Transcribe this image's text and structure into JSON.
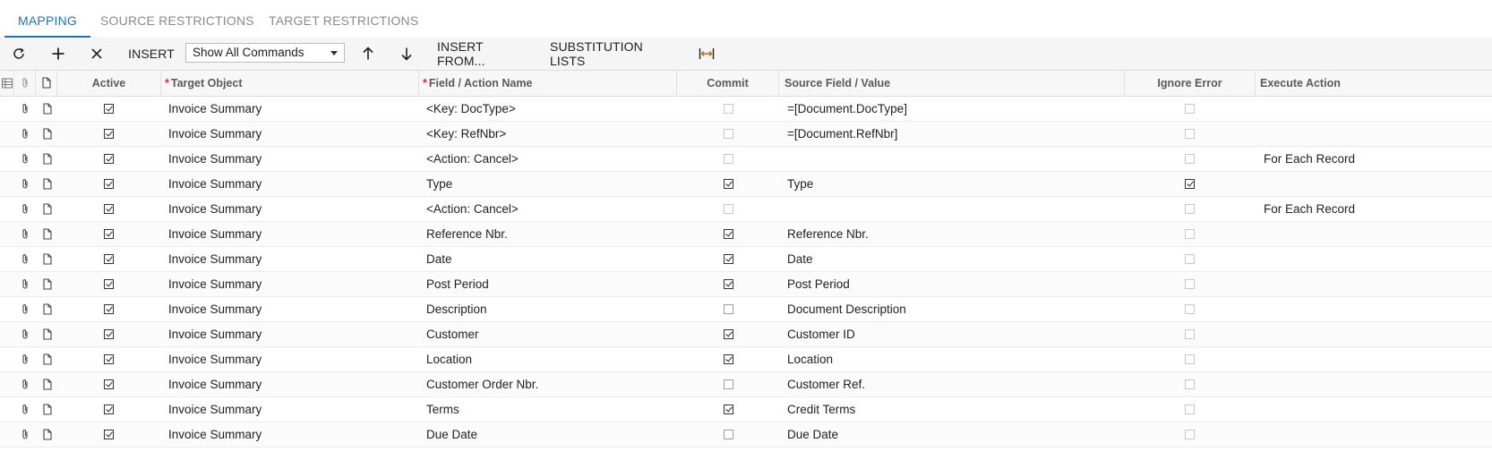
{
  "tabs": [
    {
      "label": "MAPPING",
      "active": true
    },
    {
      "label": "SOURCE RESTRICTIONS",
      "active": false
    },
    {
      "label": "TARGET RESTRICTIONS",
      "active": false
    }
  ],
  "toolbar": {
    "refresh_icon": "refresh-icon",
    "add_icon": "plus-icon",
    "delete_icon": "close-icon",
    "insert_label": "INSERT",
    "command_filter": "Show All Commands",
    "move_up_icon": "arrow-up-icon",
    "move_down_icon": "arrow-down-icon",
    "insert_from_label": "INSERT FROM...",
    "substitution_lists_label": "SUBSTITUTION LISTS",
    "fit_columns_icon": "fit-columns-icon"
  },
  "grid": {
    "columns": {
      "active": "Active",
      "target_object": "Target Object",
      "field_action": "Field / Action Name",
      "commit": "Commit",
      "source_field": "Source Field / Value",
      "ignore_error": "Ignore Error",
      "execute_action": "Execute Action"
    },
    "rows": [
      {
        "active": true,
        "target": "Invoice Summary",
        "field": "<Key: DocType>",
        "commit": false,
        "commit_enabled": false,
        "source": "=[Document.DocType]",
        "ignore_error": false,
        "execute": ""
      },
      {
        "active": true,
        "target": "Invoice Summary",
        "field": "<Key: RefNbr>",
        "commit": false,
        "commit_enabled": false,
        "source": "=[Document.RefNbr]",
        "ignore_error": false,
        "execute": ""
      },
      {
        "active": true,
        "target": "Invoice Summary",
        "field": "<Action: Cancel>",
        "commit": false,
        "commit_enabled": false,
        "source": "",
        "ignore_error": false,
        "execute": "For Each Record"
      },
      {
        "active": true,
        "target": "Invoice Summary",
        "field": "Type",
        "commit": true,
        "commit_enabled": true,
        "source": "Type",
        "ignore_error": true,
        "execute": ""
      },
      {
        "active": true,
        "target": "Invoice Summary",
        "field": "<Action: Cancel>",
        "commit": false,
        "commit_enabled": false,
        "source": "",
        "ignore_error": false,
        "execute": "For Each Record"
      },
      {
        "active": true,
        "target": "Invoice Summary",
        "field": "Reference Nbr.",
        "commit": true,
        "commit_enabled": true,
        "source": "Reference Nbr.",
        "ignore_error": false,
        "execute": ""
      },
      {
        "active": true,
        "target": "Invoice Summary",
        "field": "Date",
        "commit": true,
        "commit_enabled": true,
        "source": "Date",
        "ignore_error": false,
        "execute": ""
      },
      {
        "active": true,
        "target": "Invoice Summary",
        "field": "Post Period",
        "commit": true,
        "commit_enabled": true,
        "source": "Post Period",
        "ignore_error": false,
        "execute": ""
      },
      {
        "active": true,
        "target": "Invoice Summary",
        "field": "Description",
        "commit": false,
        "commit_enabled": true,
        "source": "Document Description",
        "ignore_error": false,
        "execute": ""
      },
      {
        "active": true,
        "target": "Invoice Summary",
        "field": "Customer",
        "commit": true,
        "commit_enabled": true,
        "source": "Customer ID",
        "ignore_error": false,
        "execute": ""
      },
      {
        "active": true,
        "target": "Invoice Summary",
        "field": "Location",
        "commit": true,
        "commit_enabled": true,
        "source": "Location",
        "ignore_error": false,
        "execute": ""
      },
      {
        "active": true,
        "target": "Invoice Summary",
        "field": "Customer Order Nbr.",
        "commit": false,
        "commit_enabled": true,
        "source": "Customer Ref.",
        "ignore_error": false,
        "execute": ""
      },
      {
        "active": true,
        "target": "Invoice Summary",
        "field": "Terms",
        "commit": true,
        "commit_enabled": true,
        "source": "Credit Terms",
        "ignore_error": false,
        "execute": ""
      },
      {
        "active": true,
        "target": "Invoice Summary",
        "field": "Due Date",
        "commit": false,
        "commit_enabled": true,
        "source": "Due Date",
        "ignore_error": false,
        "execute": ""
      }
    ]
  }
}
